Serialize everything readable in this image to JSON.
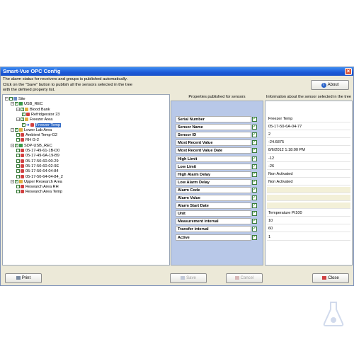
{
  "window": {
    "title": "Smart-Vue OPC Config",
    "info_line1": "The alarm status for receivers and groups is published automatically.",
    "info_line2": "Click on the \"Save\" button to publish all the sensors selected in the tree",
    "info_line3": "with the defined property list.",
    "about_label": "About"
  },
  "panels": {
    "properties_header": "Properties published for sensors",
    "info_header": "Information about the sensor selected in the tree"
  },
  "tree": [
    {
      "label": "Site",
      "level": 0,
      "icon": "site-icon"
    },
    {
      "label": "USB_REC",
      "level": 1,
      "icon": "receiver-icon"
    },
    {
      "label": "Blood Bank",
      "level": 2,
      "icon": "group-icon"
    },
    {
      "label": "Refridgerator 23",
      "level": 3,
      "icon": "sensor-icon"
    },
    {
      "label": "Freezer Area",
      "level": 2,
      "icon": "group-icon"
    },
    {
      "label": "Freezer Temp",
      "level": 3,
      "icon": "sensor-icon",
      "selected": true
    },
    {
      "label": "Lower Lab Area",
      "level": 1,
      "icon": "group-icon"
    },
    {
      "label": "Ambient Temp-G2",
      "level": 2,
      "icon": "sensor-icon"
    },
    {
      "label": "RH G-2",
      "level": 2,
      "icon": "sensor-icon"
    },
    {
      "label": "SDP-USB_REC",
      "level": 1,
      "icon": "receiver-icon"
    },
    {
      "label": "05-17-49-61-1B-D0",
      "level": 2,
      "icon": "sensor-icon"
    },
    {
      "label": "05-17-49-6A-19-B9",
      "level": 2,
      "icon": "sensor-icon"
    },
    {
      "label": "05-17-50-60-00-29",
      "level": 2,
      "icon": "sensor-icon"
    },
    {
      "label": "05-17-50-60-02-9E",
      "level": 2,
      "icon": "sensor-icon"
    },
    {
      "label": "05-17-50-64-04-84",
      "level": 2,
      "icon": "sensor-icon"
    },
    {
      "label": "05-17-50-64-04-84_2",
      "level": 2,
      "icon": "sensor-icon"
    },
    {
      "label": "Upper Research Area",
      "level": 1,
      "icon": "group-icon"
    },
    {
      "label": "Research Area RH",
      "level": 2,
      "icon": "sensor-icon"
    },
    {
      "label": "Research Area Temp",
      "level": 2,
      "icon": "sensor-icon"
    }
  ],
  "properties": [
    {
      "label": "Serial Number",
      "checked": true
    },
    {
      "label": "Sensor Name",
      "checked": true
    },
    {
      "label": "Sensor ID",
      "checked": true
    },
    {
      "label": "Most Recent Value",
      "checked": true
    },
    {
      "label": "Most Recent Value Date",
      "checked": true
    },
    {
      "label": "High Limit",
      "checked": true
    },
    {
      "label": "Low Limit",
      "checked": true
    },
    {
      "label": "High Alarm Delay",
      "checked": true
    },
    {
      "label": "Low Alarm Delay",
      "checked": true
    },
    {
      "label": "Alarm Code",
      "checked": true
    },
    {
      "label": "Alarm Value",
      "checked": true
    },
    {
      "label": "Alarm Start Date",
      "checked": true
    },
    {
      "label": "Unit",
      "checked": true
    },
    {
      "label": "Measurement interval",
      "checked": true
    },
    {
      "label": "Transfer interval",
      "checked": true
    },
    {
      "label": "Active",
      "checked": true
    }
  ],
  "sensor_info": [
    "Freezer Temp",
    "05-17-50-6A-04-77",
    "2",
    "-24.6875",
    "8/6/2012 1:18:00 PM",
    "-12",
    "-26",
    "Non Activated",
    "Non Activated",
    "",
    "",
    "",
    "Temperature Pt100",
    "10",
    "60",
    "1"
  ],
  "buttons": {
    "print": "Print",
    "save": "Save",
    "cancel": "Cancel",
    "close": "Close"
  },
  "colors": {
    "titlebar": "#1d5ad8",
    "selection": "#316ac5",
    "properties_bg": "#b8c8e8"
  }
}
